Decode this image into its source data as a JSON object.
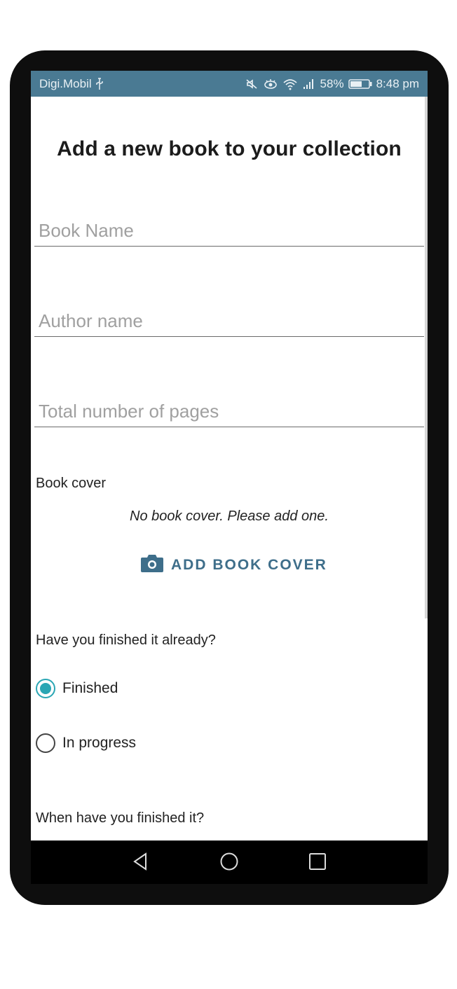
{
  "status_bar": {
    "carrier": "Digi.Mobil",
    "battery_percent": "58%",
    "time": "8:48 pm",
    "icons": [
      "usb-icon",
      "mute-icon",
      "eye-icon",
      "wifi-icon",
      "signal-icon",
      "battery-icon"
    ]
  },
  "form": {
    "title": "Add a new book to your collection",
    "book_name_placeholder": "Book Name",
    "author_placeholder": "Author name",
    "pages_placeholder": "Total number of pages",
    "cover_label": "Book cover",
    "no_cover_text": "No book cover. Please add one.",
    "add_cover_label": "ADD BOOK COVER",
    "finished_question": "Have you finished it already?",
    "options": [
      {
        "label": "Finished",
        "checked": true
      },
      {
        "label": "In progress",
        "checked": false
      }
    ],
    "finished_date_question": "When have you finished it?"
  },
  "colors": {
    "status_bar": "#4a7a93",
    "accent": "#3e6e8a",
    "radio_checked": "#2aa6b4"
  }
}
